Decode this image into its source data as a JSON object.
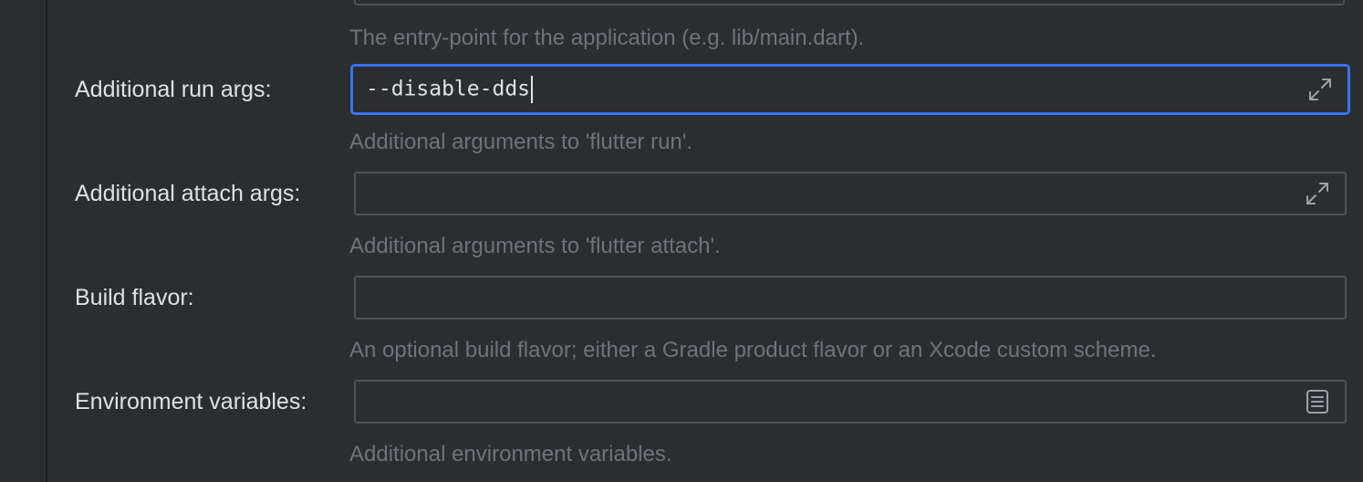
{
  "top_field": {
    "hint": "The entry-point for the application (e.g. lib/main.dart)."
  },
  "run_args": {
    "label": "Additional run args:",
    "value": "--disable-dds",
    "hint": "Additional arguments to 'flutter run'.",
    "icon": "expand-icon"
  },
  "attach_args": {
    "label": "Additional attach args:",
    "value": "",
    "hint": "Additional arguments to 'flutter attach'.",
    "icon": "expand-icon"
  },
  "build_flavor": {
    "label": "Build flavor:",
    "value": "",
    "hint": "An optional build flavor; either a Gradle product flavor or an Xcode custom scheme."
  },
  "env_vars": {
    "label": "Environment variables:",
    "value": "",
    "hint": "Additional environment variables.",
    "icon": "document-icon"
  },
  "colors": {
    "background": "#2b2d30",
    "focus_border": "#3574f0",
    "field_border": "#4e5157",
    "label_text": "#dfe1e5",
    "hint_text": "#6f737a"
  }
}
